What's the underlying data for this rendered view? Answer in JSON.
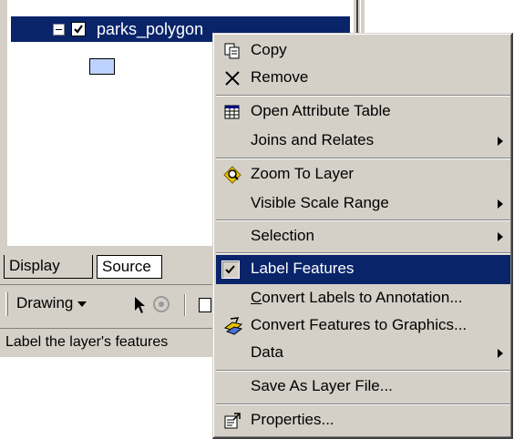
{
  "toc": {
    "layer_name": "parks_polygon",
    "tabs": [
      "Display",
      "Source"
    ]
  },
  "toolbar": {
    "drawing_label": "Drawing"
  },
  "statusbar": {
    "text": "Label the layer's features"
  },
  "context_menu": {
    "copy": "Copy",
    "remove": "Remove",
    "open_attribute_table": "Open Attribute Table",
    "joins_and_relates": "Joins and Relates",
    "zoom_to_layer": "Zoom To Layer",
    "visible_scale_range": "Visible Scale Range",
    "selection": "Selection",
    "label_features": "Label Features",
    "convert_labels_rest": "onvert Labels to Annotation...",
    "convert_labels_mnemonic": "C",
    "convert_features": "Convert Features to Graphics...",
    "data": "Data",
    "save_as_layer_file": "Save As Layer File...",
    "properties": "Properties..."
  },
  "colors": {
    "highlight": "#0a246a",
    "menu_face": "#d4d0c8",
    "symbol_fill": "#bed2ff"
  }
}
